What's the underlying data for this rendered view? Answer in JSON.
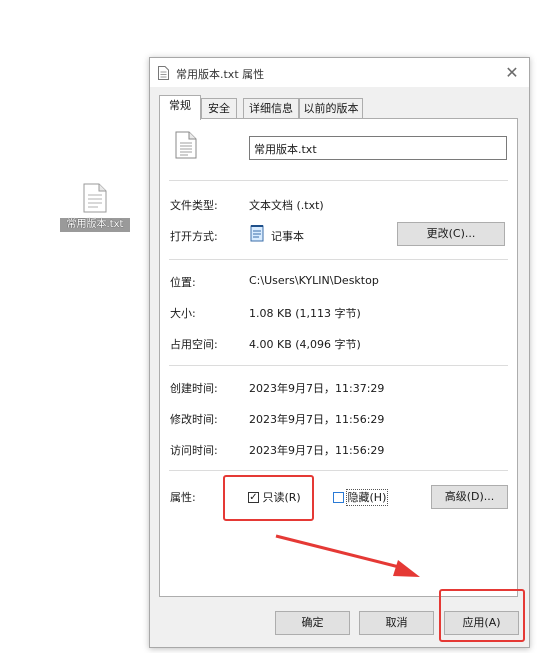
{
  "desktop": {
    "file_label": "常用版本.txt"
  },
  "dialog": {
    "title": "常用版本.txt 属性",
    "close_glyph": "✕",
    "tabs": [
      {
        "label": "常规"
      },
      {
        "label": "安全"
      },
      {
        "label": "详细信息"
      },
      {
        "label": "以前的版本"
      }
    ],
    "general": {
      "filename": "常用版本.txt",
      "file_type_label": "文件类型:",
      "file_type_value": "文本文档 (.txt)",
      "opens_with_label": "打开方式:",
      "opens_with_value": "记事本",
      "change_button": "更改(C)...",
      "location_label": "位置:",
      "location_value": "C:\\Users\\KYLIN\\Desktop",
      "size_label": "大小:",
      "size_value": "1.08 KB (1,113 字节)",
      "size_on_disk_label": "占用空间:",
      "size_on_disk_value": "4.00 KB (4,096 字节)",
      "created_label": "创建时间:",
      "created_value": "2023年9月7日，11:37:29",
      "modified_label": "修改时间:",
      "modified_value": "2023年9月7日，11:56:29",
      "accessed_label": "访问时间:",
      "accessed_value": "2023年9月7日，11:56:29",
      "attributes_label": "属性:",
      "readonly_label": "只读(R)",
      "readonly_checked": true,
      "hidden_label": "隐藏(H)",
      "hidden_checked": false,
      "advanced_button": "高级(D)..."
    },
    "footer": {
      "ok_button": "确定",
      "cancel_button": "取消",
      "apply_button": "应用(A)"
    }
  },
  "annotations": {
    "highlight_color": "#e53935"
  }
}
